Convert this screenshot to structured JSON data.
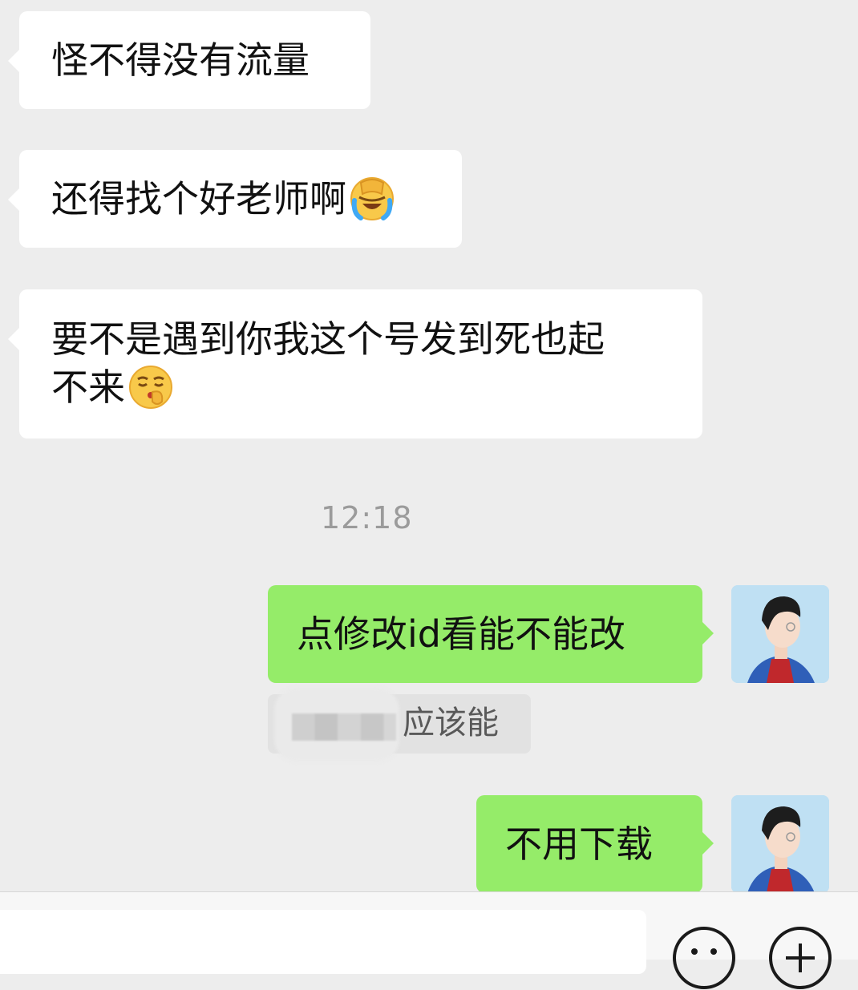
{
  "messages": [
    {
      "side": "in",
      "text": "怪不得没有流量"
    },
    {
      "side": "in",
      "text": "还得找个好老师啊",
      "emoji": "facepalm-crying-emoji"
    },
    {
      "side": "in",
      "line1": "要不是遇到你我这个号发到死也起",
      "line2": "不来",
      "emoji": "shushing-face-emoji"
    },
    {
      "side": "out",
      "text": "点修改id看能不能改",
      "quote": "应该能"
    },
    {
      "side": "out",
      "text": "不用下载"
    }
  ],
  "timestamp": "12:18",
  "colors": {
    "background": "#ededed",
    "incoming_bubble": "#ffffff",
    "outgoing_bubble": "#95ec69",
    "timestamp_text": "#9b9b9b"
  },
  "bottom_bar": {
    "icons": [
      "emoji-face-icon",
      "plus-icon"
    ]
  }
}
